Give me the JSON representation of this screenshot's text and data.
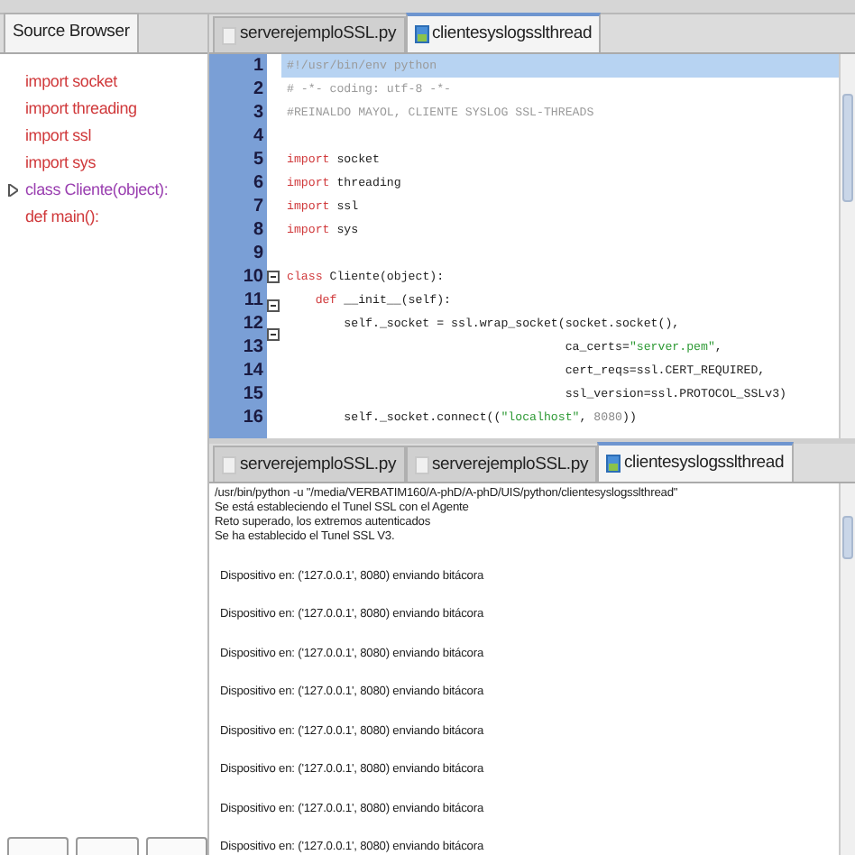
{
  "sidebar": {
    "tab": "Source Browser",
    "items": [
      {
        "kind": "leaf",
        "label": "import socket",
        "color": "#d0393b"
      },
      {
        "kind": "leaf",
        "label": "import threading",
        "color": "#d0393b"
      },
      {
        "kind": "leaf",
        "label": "import ssl",
        "color": "#d0393b"
      },
      {
        "kind": "leaf",
        "label": "import sys",
        "color": "#d0393b"
      },
      {
        "kind": "branch",
        "label": "class Cliente(object):",
        "color": "#9a3fb0",
        "expanded": false
      },
      {
        "kind": "leaf",
        "label": "def main():",
        "color": "#d0393b"
      }
    ]
  },
  "editor": {
    "tabs": [
      {
        "label": "serverejemploSSL.py",
        "selected": false
      },
      {
        "label": "clientesyslogsslthread",
        "selected": true
      }
    ],
    "lines": [
      {
        "number": "1",
        "selected": true,
        "fold": false,
        "tokens": [
          {
            "kind": "comment",
            "text": "#!/usr/bin/env python"
          }
        ]
      },
      {
        "number": "2",
        "selected": false,
        "fold": false,
        "tokens": [
          {
            "kind": "comment",
            "text": "# -*- coding: utf-8 -*-"
          }
        ]
      },
      {
        "number": "3",
        "selected": false,
        "fold": false,
        "tokens": [
          {
            "kind": "comment",
            "text": "#REINALDO MAYOL, CLIENTE SYSLOG SSL-THREADS"
          }
        ]
      },
      {
        "number": "4",
        "selected": false,
        "fold": false
      },
      {
        "number": "5",
        "selected": false,
        "fold": false,
        "tokens": [
          {
            "kind": "keyword",
            "text": "import"
          },
          {
            "kind": "plain",
            "text": " socket"
          }
        ]
      },
      {
        "number": "6",
        "selected": false,
        "fold": false,
        "tokens": [
          {
            "kind": "keyword",
            "text": "import"
          },
          {
            "kind": "plain",
            "text": " threading"
          }
        ]
      },
      {
        "number": "7",
        "selected": false,
        "fold": false,
        "tokens": [
          {
            "kind": "keyword",
            "text": "import"
          },
          {
            "kind": "plain",
            "text": " ssl"
          }
        ]
      },
      {
        "number": "8",
        "selected": false,
        "fold": false,
        "tokens": [
          {
            "kind": "keyword",
            "text": "import"
          },
          {
            "kind": "plain",
            "text": " sys"
          }
        ]
      },
      {
        "number": "9",
        "selected": false,
        "fold": false
      },
      {
        "number": "10",
        "selected": false,
        "fold": true,
        "tokens": [
          {
            "kind": "keyword",
            "text": "class"
          },
          {
            "kind": "plain",
            "text": " Cliente(object):"
          }
        ]
      },
      {
        "number": "11",
        "selected": false,
        "fold": true,
        "tokens": [
          {
            "kind": "keyword",
            "text": "    def"
          },
          {
            "kind": "plain",
            "text": " __init__(self):"
          }
        ]
      },
      {
        "number": "12",
        "selected": false,
        "fold": true,
        "tokens": [
          {
            "kind": "plain",
            "text": "        self._socket = ssl.wrap_socket(socket.socket(),"
          }
        ]
      },
      {
        "number": "13",
        "selected": false,
        "fold": false,
        "tokens": [
          {
            "kind": "plain",
            "text": "                                       ca_certs="
          },
          {
            "kind": "string",
            "text": "\"server.pem\""
          },
          {
            "kind": "plain",
            "text": ","
          }
        ]
      },
      {
        "number": "14",
        "selected": false,
        "fold": false,
        "tokens": [
          {
            "kind": "plain",
            "text": "                                       cert_reqs=ssl.CERT_REQUIRED,"
          }
        ]
      },
      {
        "number": "15",
        "selected": false,
        "fold": false,
        "tokens": [
          {
            "kind": "plain",
            "text": "                                       ssl_version=ssl.PROTOCOL_SSLv3)"
          }
        ]
      },
      {
        "number": "16",
        "selected": false,
        "fold": false,
        "tokens": [
          {
            "kind": "plain",
            "text": "        self._socket.connect(("
          },
          {
            "kind": "string",
            "text": "\"localhost\""
          },
          {
            "kind": "plain",
            "text": ", "
          },
          {
            "kind": "number",
            "text": "8080"
          },
          {
            "kind": "plain",
            "text": "))"
          }
        ]
      }
    ]
  },
  "output": {
    "tabs": [
      {
        "label": "serverejemploSSL.py",
        "selected": false
      },
      {
        "label": "serverejemploSSL.py",
        "selected": false
      },
      {
        "label": "clientesyslogsslthread",
        "selected": true
      }
    ],
    "header_lines": [
      "/usr/bin/python -u  \"/media/VERBATIM160/A-phD/A-phD/UIS/python/clientesyslogsslthread\"",
      "Se está estableciendo el Tunel SSL con el Agente",
      "Reto superado, los extremos autenticados",
      "Se ha establecido el Tunel SSL V3."
    ],
    "device_lines": [
      "Dispositivo en: ('127.0.0.1', 8080) enviando bitácora",
      "Dispositivo en: ('127.0.0.1', 8080) enviando bitácora",
      "Dispositivo en: ('127.0.0.1', 8080) enviando bitácora",
      "Dispositivo en: ('127.0.0.1', 8080) enviando bitácora",
      "Dispositivo en: ('127.0.0.1', 8080) enviando bitácora",
      "Dispositivo en: ('127.0.0.1', 8080) enviando bitácora",
      "Dispositivo en: ('127.0.0.1', 8080) enviando bitácora",
      "Dispositivo en: ('127.0.0.1', 8080) enviando bitácora"
    ]
  }
}
